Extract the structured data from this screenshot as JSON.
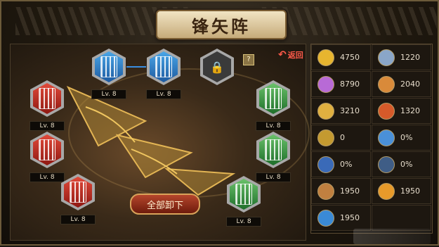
{
  "title": "锋矢阵",
  "back_label": "返回",
  "help_label": "?",
  "unload_label": "全部卸下",
  "slots": [
    {
      "id": "blue-1",
      "color": "blue",
      "level": "Lv. 8"
    },
    {
      "id": "blue-2",
      "color": "blue",
      "level": "Lv. 8"
    },
    {
      "id": "locked",
      "color": "locked",
      "level": ""
    },
    {
      "id": "red-1",
      "color": "red",
      "level": "Lv. 8"
    },
    {
      "id": "red-2",
      "color": "red",
      "level": "Lv. 8"
    },
    {
      "id": "red-3",
      "color": "red",
      "level": "Lv. 8"
    },
    {
      "id": "green-1",
      "color": "green",
      "level": "Lv. 8"
    },
    {
      "id": "green-2",
      "color": "green",
      "level": "Lv. 8"
    },
    {
      "id": "green-3",
      "color": "green",
      "level": "Lv. 8"
    }
  ],
  "stats": [
    {
      "icon": "gold-coin-icon",
      "value": "4750",
      "color": "#e7b52f"
    },
    {
      "icon": "shield-icon",
      "value": "1220",
      "color": "#8aa6c8"
    },
    {
      "icon": "purple-orb-icon",
      "value": "8790",
      "color": "#b86ad6"
    },
    {
      "icon": "warrior-icon",
      "value": "2040",
      "color": "#d98a3a"
    },
    {
      "icon": "golden-sword-icon",
      "value": "3210",
      "color": "#e0b040"
    },
    {
      "icon": "flame-head-icon",
      "value": "1320",
      "color": "#d65a2a"
    },
    {
      "icon": "crest-icon",
      "value": "0",
      "color": "#c49a30"
    },
    {
      "icon": "blue-wave-icon",
      "value": "0%",
      "color": "#4a90d8"
    },
    {
      "icon": "blue-arrow-icon",
      "value": "0%",
      "color": "#3a6ab8"
    },
    {
      "icon": "dark-blade-icon",
      "value": "0%",
      "color": "#3f5d86"
    },
    {
      "icon": "beast-icon",
      "value": "1950",
      "color": "#c08040"
    },
    {
      "icon": "sun-burst-icon",
      "value": "1950",
      "color": "#e79a2a"
    },
    {
      "icon": "blue-claw-icon",
      "value": "1950",
      "color": "#3a8ad6"
    },
    {
      "icon": "",
      "value": "",
      "color": ""
    }
  ]
}
